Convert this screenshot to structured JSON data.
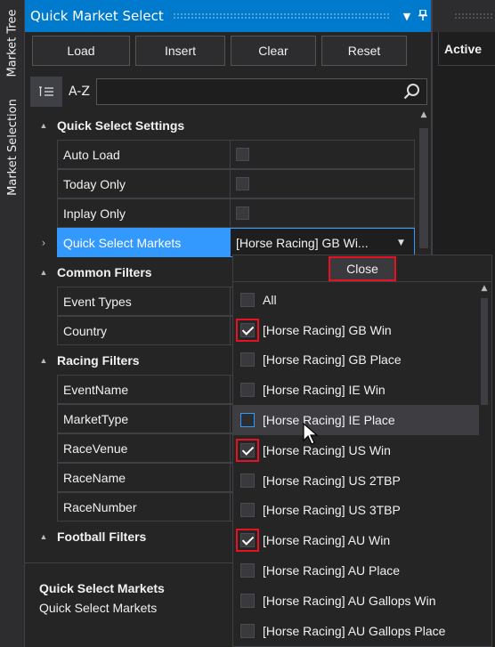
{
  "side_tabs": {
    "market_tree": "Market Tree",
    "market_selection": "Market Selection"
  },
  "panel": {
    "title": "Quick Market Select",
    "toolbar": {
      "load": "Load",
      "insert": "Insert",
      "clear": "Clear",
      "reset": "Reset"
    },
    "sort_az": "A-Z",
    "search": {
      "value": "",
      "placeholder": ""
    }
  },
  "grid": {
    "quick_select_settings": {
      "label": "Quick Select Settings",
      "rows": [
        {
          "name": "Auto Load",
          "checked": false
        },
        {
          "name": "Today Only",
          "checked": false
        },
        {
          "name": "Inplay Only",
          "checked": false
        }
      ],
      "markets_row": {
        "name": "Quick Select Markets",
        "value": "[Horse Racing] GB Wi..."
      }
    },
    "common_filters": {
      "label": "Common Filters",
      "rows": [
        "Event Types",
        "Country"
      ]
    },
    "racing_filters": {
      "label": "Racing Filters",
      "rows": [
        "EventName",
        "MarketType",
        "RaceVenue",
        "RaceName",
        "RaceNumber"
      ]
    },
    "football_filters": {
      "label": "Football Filters"
    }
  },
  "description": {
    "title": "Quick Select Markets",
    "text": "Quick Select Markets"
  },
  "right_panel": {
    "header": "Active"
  },
  "dropdown": {
    "close_label": "Close",
    "items": [
      {
        "label": "All",
        "checked": false
      },
      {
        "label": "[Horse Racing] GB Win",
        "checked": true
      },
      {
        "label": "[Horse Racing] GB Place",
        "checked": false
      },
      {
        "label": "[Horse Racing] IE Win",
        "checked": false
      },
      {
        "label": "[Horse Racing] IE Place",
        "checked": false
      },
      {
        "label": "[Horse Racing] US Win",
        "checked": true
      },
      {
        "label": "[Horse Racing] US 2TBP",
        "checked": false
      },
      {
        "label": "[Horse Racing] US 3TBP",
        "checked": false
      },
      {
        "label": "[Horse Racing] AU Win",
        "checked": true
      },
      {
        "label": "[Horse Racing] AU Place",
        "checked": false
      },
      {
        "label": "[Horse Racing] AU Gallops Win",
        "checked": false
      },
      {
        "label": "[Horse Racing] AU Gallops Place",
        "checked": false
      }
    ]
  },
  "colors": {
    "accent": "#007acc",
    "selection": "#3399ff",
    "highlight": "#e81123",
    "background": "#252526"
  },
  "icons": {
    "search": "search-icon",
    "pin": "pin-icon",
    "dropdown": "chevron-down-icon",
    "categorized": "categorized-icon"
  }
}
